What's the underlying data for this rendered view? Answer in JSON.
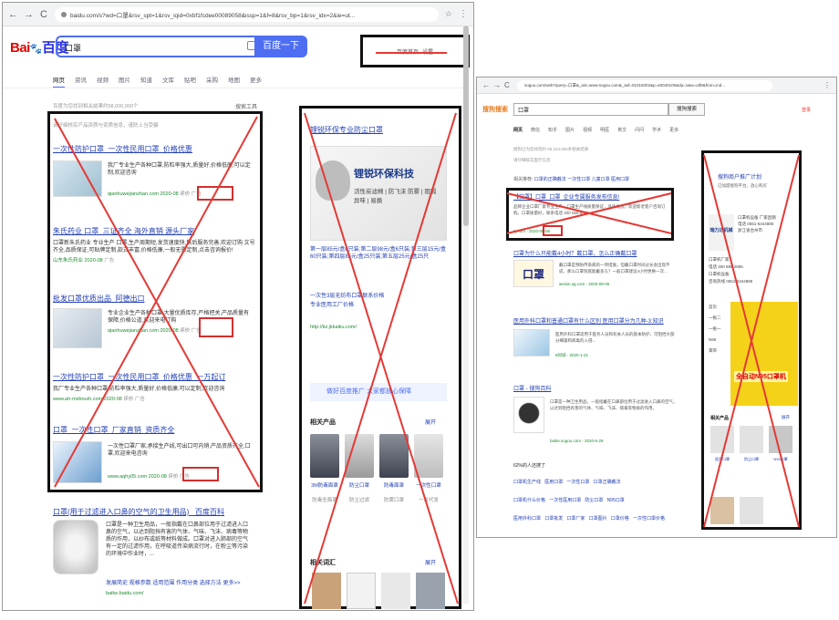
{
  "baidu": {
    "url": "baidu.com/s?wd=口罩&rsv_spt=1&rsv_iqid=0xbf1fcdee00089058&issp=1&f=8&rsv_bp=1&rsv_idx=2&ie=ut...",
    "logo": {
      "bai": "Bai",
      "paw": "du",
      "du": "百度"
    },
    "query": "口罩",
    "search_button": "百度一下",
    "top_link": "百度首页",
    "top_link_2": "设置",
    "tabs": [
      "网页",
      "资讯",
      "视频",
      "图片",
      "知道",
      "文库",
      "贴吧",
      "采购",
      "地图",
      "更多"
    ],
    "result_count": "百度为您找到相关结果约58,000,000个",
    "tools": "搜索工具",
    "notice": "请仔细核实产品资质与资质信息，谨防上当受骗",
    "results": [
      {
        "title": "一次性防护口罩_一次性民用口罩_价格优惠",
        "desc": "我厂专业生产各种口罩,防粒率强大,质量好,价格低廉,可以定制,欢迎咨询",
        "url": "qianhuwejianzhan.com",
        "date": "2020-08",
        "badge": "评价",
        "ad": "广告"
      },
      {
        "title": "朱氏药业 口罩_三证齐全 海外直销 源头厂家",
        "desc": "口罩新朱氏药业 专业生产 口罩,生产周期短,发货速度快,售后服务完善,欢迎订购 文号齐全,品质保证,可贴牌定制,款式丰富,价格低廉,一般无需定制,点击咨询报价!",
        "url": "山东朱氏药业",
        "date": "2020-08",
        "badge": "",
        "ad": "广告"
      },
      {
        "title": "批发口罩优质出品_阿德出口",
        "desc": "专业企业生产各种口罩 大量优质库存,严格把关,产品质量有保障,价格公道,欢迎来电订购",
        "url": "qianhuwejianzhan.com",
        "date": "2020-08",
        "badge": "评价",
        "ad": "广告"
      },
      {
        "title": "一次性防护口罩_一次性民用口罩_价格优惠_一万起订",
        "desc": "我厂专业生产各种口罩,防粒率强大,质量好,价格低廉,可以定制,欢迎咨询",
        "url": "www.ah-mxbrush.com",
        "date": "2020-08",
        "badge": "评价",
        "ad": "广告"
      },
      {
        "title": "口罩_一次性口罩_厂家直销_资质齐全",
        "desc": "一次性口罩厂家,承接生产线,可出口可内销,产品资质齐全,口罩,欢迎来电咨询",
        "url": "www.aqhy05.com",
        "date": "2020-08",
        "badge": "评价",
        "ad": "广告"
      }
    ],
    "wiki": {
      "title": "口罩(用于过滤进入口鼻的空气的卫生用品) _百度百科",
      "text": "口罩是一种卫生用品，一般指戴在口鼻部位用于过滤进入口鼻的空气，以达到阻挡有害的气体、气味、飞沫、病毒等物质的作用，以纱布或纸等材料做成。口罩对进入肺部的空气有一定的过滤作用，在呼吸道传染病流行时，在粉尘等污染的环境中作业时，...",
      "links": [
        "发展简史",
        "规格参数",
        "适用范围",
        "作用分类",
        "选择方法",
        "更多>>"
      ],
      "url": "baike.baidu.com/"
    },
    "ad": {
      "title": "锂锐环保专业防尘口罩",
      "brand": "锂锐环保科技",
      "slogan": "活性炭滤棉 | 防飞沫 防雾 | 阻隔异味 | 易换",
      "text": "第一层85元/盒6只装;第二层98元/盒6只装;第三层15元/盒60只装;第四层85元/盒25只装;第五层25元/盒25只",
      "links": [
        "一次性3层无纺布口罩联系价格",
        "专业医用工厂价格"
      ],
      "url": "http://kz.jkkaiku.com/",
      "join": "做好百度推广 大家都放心保障",
      "section_products": "相关产品",
      "products": [
        "3M防毒面罩",
        "防尘口罩",
        "防毒面罩",
        "一次性口罩"
      ],
      "sublabels": [
        "防毒全面罩",
        "防尘过滤",
        "防雾口罩",
        "一件代发"
      ],
      "more": "展开",
      "section_terms": "相关词汇",
      "more2": "展开"
    },
    "colors": {
      "accent": "#4e6ef2",
      "link": "#2440b3",
      "url": "#1b8a2f"
    }
  },
  "sogou": {
    "url": "sogou.com/web?query=口罩&_ast=www.sogou.com&_asf=01015002&p=40040100&dp=1&w=utf8&from=ind...",
    "logo": "搜狗搜索",
    "query": "口罩",
    "search_button": "搜狗搜索",
    "login": "登录",
    "tabs": [
      "网页",
      "微信",
      "知乎",
      "图片",
      "视频",
      "明医",
      "英文",
      "问问",
      "学术",
      "更多"
    ],
    "result_count": "搜狗已为您找到约 58,234,856条相关结果",
    "notice": "请仔细核实医疗信息",
    "related_label": "相关推荐:",
    "related": [
      "口罩的正确戴法",
      "一次性口罩",
      "儿童口罩",
      "医用口罩"
    ],
    "results": [
      {
        "title": "【口罩】口罩_口罩_企业专属服务发布信息!",
        "desc": "品牌企业口罩厂家专业生产，口罩生产线质量保证，品质优良，欢迎新老客户咨询订购。口罩质量好，联系电话 400 658 8888",
        "url": "kj.com",
        "date": "2020-08-06"
      },
      {
        "title": "口罩为什么只能戴4小时？戴口罩，怎么正确戴口罩",
        "desc": "戴口罩是预防传染病的一项措施，但戴口罩时间过长会出现不适，那么口罩到底能戴多久？一般口罩建议4小时更换一次...",
        "url": "weixin.sg.com",
        "date": "2020-08-06"
      },
      {
        "title": "医用外科口罩和普通口罩有什么区别 医用口罩分为几种-3:知识",
        "desc": "医用外科口罩适用于医务人员和有关人员的基本防护，可阻挡大部分细菌和病毒的入侵...",
        "url": "8同城",
        "date": "2020-1-21"
      },
      {
        "title": "口罩 - 搜狗百科",
        "desc": "口罩是一种卫生用品，一般指戴在口鼻部位用于过滤进入口鼻的空气，以达到阻挡有害的气体、气味、飞沫、病毒等物质的作用。",
        "url": "baike.sogou.com",
        "date": "2020-6-28"
      }
    ],
    "chips_label": "62%的人还搜了",
    "chips": [
      "口罩机生产线",
      "医用口罩",
      "一次性口罩",
      "口罩正确戴法",
      "口罩机什么价格",
      "一次性医用口罩",
      "防尘口罩",
      "N95口罩",
      "医用外科口罩",
      "口罩批发",
      "口罩厂家",
      "口罩图片",
      "口罩价格",
      "一次性口罩价格"
    ],
    "side": {
      "title": "搜狗商户推广计划",
      "desc": "已加盟搜狗平台，放心购买",
      "logo": "瑞力达机械",
      "info": [
        "口罩机设备 厂家直销",
        "电话 0551-6344885",
        "浙江省台州市"
      ],
      "rows": [
        "口罩机厂家",
        "电话 400 698 2855",
        "口罩机设备",
        "咨询热线 0551-6344885"
      ],
      "nav": [
        "首页",
        "一拖二",
        "一拖一",
        "N95",
        "耳带"
      ],
      "banner": "全自动N95口罩机",
      "section": "相关产品",
      "more": "展开",
      "products": [
        "医用口罩",
        "防尘口罩",
        "N95口罩"
      ]
    }
  }
}
